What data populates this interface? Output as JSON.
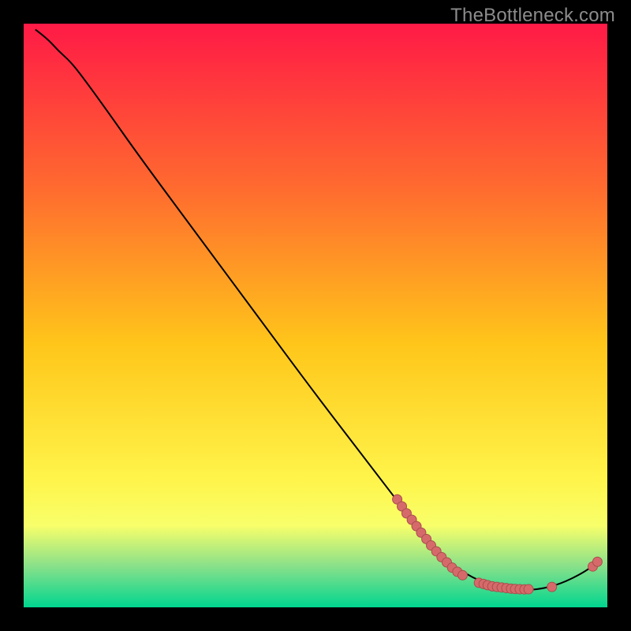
{
  "watermark": "TheBottleneck.com",
  "colors": {
    "bg": "#000000",
    "curve": "#000000",
    "marker_fill": "#d66a6a",
    "marker_stroke": "#a94e4e",
    "gradient_top": "#ff1a46",
    "gradient_mid1": "#ff6a2f",
    "gradient_mid2": "#ffc61a",
    "gradient_mid3": "#fff44a",
    "gradient_band": "#f8ff6a",
    "gradient_green1": "#88e08a",
    "gradient_green2": "#00d68f"
  },
  "chart_data": {
    "type": "line",
    "title": "",
    "xlabel": "",
    "ylabel": "",
    "xlim": [
      0,
      100
    ],
    "ylim": [
      0,
      100
    ],
    "curve": [
      {
        "x": 2.0,
        "y": 99.0
      },
      {
        "x": 4.0,
        "y": 97.5
      },
      {
        "x": 6.0,
        "y": 95.3
      },
      {
        "x": 8.0,
        "y": 93.5
      },
      {
        "x": 10.0,
        "y": 91.0
      },
      {
        "x": 14.0,
        "y": 85.5
      },
      {
        "x": 20.0,
        "y": 77.0
      },
      {
        "x": 30.0,
        "y": 63.5
      },
      {
        "x": 40.0,
        "y": 50.0
      },
      {
        "x": 50.0,
        "y": 36.5
      },
      {
        "x": 60.0,
        "y": 23.5
      },
      {
        "x": 68.0,
        "y": 13.0
      },
      {
        "x": 72.0,
        "y": 8.5
      },
      {
        "x": 76.0,
        "y": 5.5
      },
      {
        "x": 80.0,
        "y": 3.8
      },
      {
        "x": 84.0,
        "y": 3.0
      },
      {
        "x": 88.0,
        "y": 3.0
      },
      {
        "x": 92.0,
        "y": 4.0
      },
      {
        "x": 96.0,
        "y": 6.0
      },
      {
        "x": 98.0,
        "y": 7.5
      }
    ],
    "markers": [
      {
        "x": 64.0,
        "y": 18.5
      },
      {
        "x": 64.8,
        "y": 17.3
      },
      {
        "x": 65.6,
        "y": 16.1
      },
      {
        "x": 66.5,
        "y": 15.0
      },
      {
        "x": 67.3,
        "y": 13.9
      },
      {
        "x": 68.1,
        "y": 12.8
      },
      {
        "x": 69.0,
        "y": 11.7
      },
      {
        "x": 69.8,
        "y": 10.6
      },
      {
        "x": 70.7,
        "y": 9.6
      },
      {
        "x": 71.6,
        "y": 8.6
      },
      {
        "x": 72.5,
        "y": 7.7
      },
      {
        "x": 73.4,
        "y": 6.8
      },
      {
        "x": 74.3,
        "y": 6.1
      },
      {
        "x": 75.2,
        "y": 5.5
      },
      {
        "x": 78.0,
        "y": 4.2
      },
      {
        "x": 78.8,
        "y": 4.0
      },
      {
        "x": 79.5,
        "y": 3.8
      },
      {
        "x": 80.3,
        "y": 3.6
      },
      {
        "x": 81.1,
        "y": 3.5
      },
      {
        "x": 81.9,
        "y": 3.4
      },
      {
        "x": 82.7,
        "y": 3.3
      },
      {
        "x": 83.5,
        "y": 3.2
      },
      {
        "x": 84.2,
        "y": 3.15
      },
      {
        "x": 85.0,
        "y": 3.1
      },
      {
        "x": 85.8,
        "y": 3.08
      },
      {
        "x": 86.5,
        "y": 3.1
      },
      {
        "x": 90.5,
        "y": 3.5
      },
      {
        "x": 97.5,
        "y": 7.0
      },
      {
        "x": 98.3,
        "y": 7.8
      }
    ]
  }
}
